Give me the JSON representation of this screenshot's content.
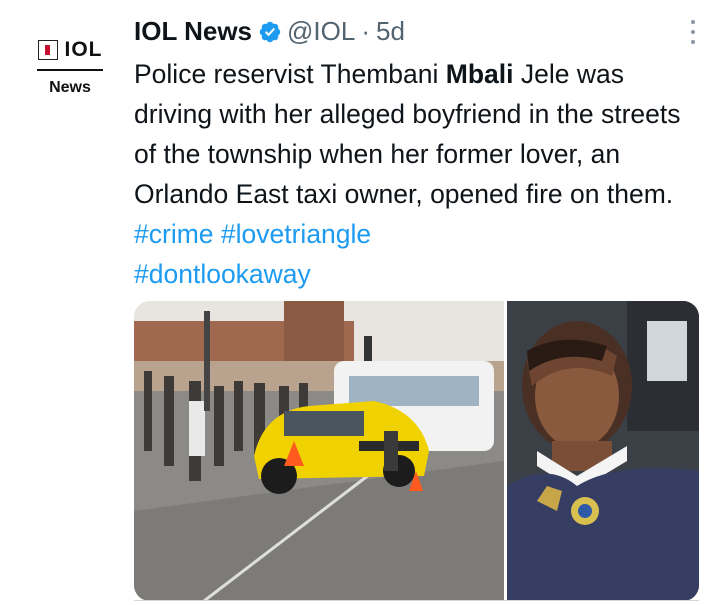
{
  "tweet": {
    "author_name": "IOL News",
    "handle": "@IOL",
    "separator": "·",
    "age": "5d",
    "text_part1": "Police reservist Thembani ",
    "text_bold": "Mbali",
    "text_part2": " Jele was driving with her alleged boyfriend in the streets of the township when her former lover, an Orlando East taxi owner, opened fire on them. ",
    "hashtags": [
      "#crime",
      "#lovetriangle",
      "#dontlookaway"
    ]
  },
  "avatar_logo": {
    "brand": "IOL",
    "subtitle": "News",
    "accent_color": "#c8102e"
  },
  "icons": {
    "verified": "verified-badge-icon",
    "more": "more-options-icon"
  },
  "colors": {
    "text": "#0f1419",
    "secondary": "#536471",
    "link": "#1d9bf0"
  }
}
